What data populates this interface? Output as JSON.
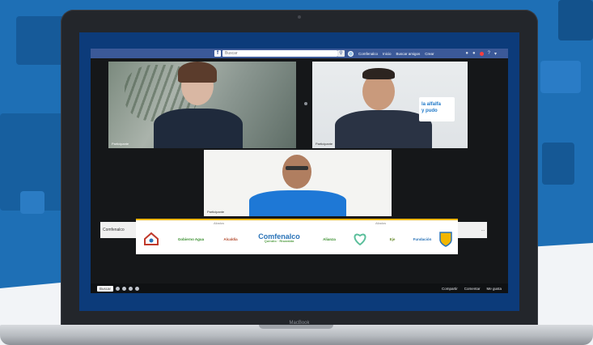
{
  "facebook": {
    "logo": "f",
    "search_placeholder": "Buscar",
    "nav_items": [
      "Comfenalco",
      "Inicio",
      "Buscar amigos",
      "Crear"
    ]
  },
  "participants": [
    "Participante",
    "Participante",
    "Participante"
  ],
  "banner": {
    "left_chip": "Comfenalco",
    "right_chip": "...",
    "label_left": "Aliados",
    "label_right": "Aliados",
    "center_logo": "Comfenalco",
    "center_logo_sub": "Quindío · Risaralda",
    "partners": [
      "Gobernación",
      "Gobierno Agua",
      "Alcaldía",
      "Alianza",
      "Eje",
      "Fundación",
      "Escudo"
    ]
  },
  "sign": {
    "line1": "la alfalfa",
    "line2": "y pudo"
  },
  "bottom_bar": {
    "input_label": "Buscar",
    "right_items": [
      "Compartir",
      "Comentar",
      "Me gusta"
    ]
  },
  "device": {
    "brand": "MacBook"
  },
  "colors": {
    "fb_blue": "#3b5998",
    "bg_blue": "#1e6fb5",
    "banner_accent": "#f2b600"
  }
}
